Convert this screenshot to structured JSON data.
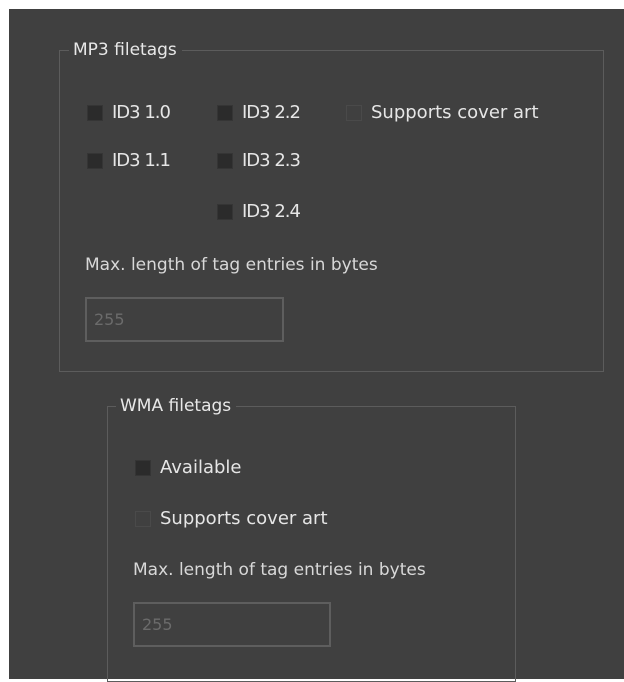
{
  "mp3": {
    "title": "MP3 filetags",
    "id3_10": "ID3 1.0",
    "id3_11": "ID3 1.1",
    "id3_22": "ID3 2.2",
    "id3_23": "ID3 2.3",
    "id3_24": "ID3 2.4",
    "cover_art": "Supports cover art",
    "max_length_label": "Max. length of tag entries in bytes",
    "max_length_value": "255"
  },
  "wma": {
    "title": "WMA filetags",
    "available": "Available",
    "cover_art": "Supports cover art",
    "max_length_label": "Max. length of tag entries in bytes",
    "max_length_value": "255"
  }
}
